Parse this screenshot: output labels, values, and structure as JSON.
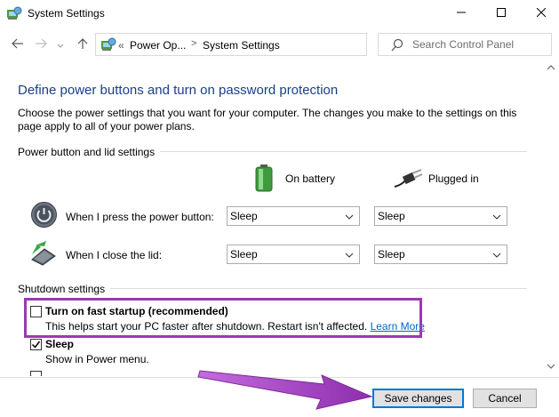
{
  "window": {
    "title": "System Settings",
    "minimize_icon": "minimize-icon",
    "maximize_icon": "maximize-icon",
    "close_icon": "close-icon"
  },
  "nav": {
    "back_icon": "arrow-left-icon",
    "forward_icon": "arrow-right-icon",
    "recent_icon": "chevron-down-icon",
    "up_icon": "arrow-up-icon",
    "address": {
      "overflow": "«",
      "crumbs": [
        "Power Op...",
        "System Settings"
      ],
      "separator": ">"
    },
    "refresh_icon": "refresh-icon",
    "search": {
      "placeholder": "Search Control Panel",
      "value": ""
    }
  },
  "page": {
    "heading": "Define power buttons and turn on password protection",
    "description": "Choose the power settings that you want for your computer. The changes you make to the settings on this page apply to all of your power plans."
  },
  "power_section": {
    "label": "Power button and lid settings",
    "columns": [
      {
        "label": "On battery",
        "icon": "battery-icon"
      },
      {
        "label": "Plugged in",
        "icon": "plug-icon"
      }
    ],
    "rows": [
      {
        "label": "When I press the power button:",
        "icon": "power-button-icon",
        "battery_value": "Sleep",
        "plugged_value": "Sleep"
      },
      {
        "label": "When I close the lid:",
        "icon": "laptop-lid-icon",
        "battery_value": "Sleep",
        "plugged_value": "Sleep"
      }
    ]
  },
  "shutdown_section": {
    "label": "Shutdown settings",
    "items": [
      {
        "label": "Turn on fast startup (recommended)",
        "description": "This helps start your PC faster after shutdown. Restart isn't affected.",
        "link": "Learn More",
        "checked": false
      },
      {
        "label": "Sleep",
        "description": "Show in Power menu.",
        "checked": true
      }
    ]
  },
  "footer": {
    "save_label": "Save changes",
    "cancel_label": "Cancel"
  },
  "colors": {
    "highlight": "#9b38b5",
    "heading": "#1a3f86",
    "link": "#0066cc",
    "primary_border": "#0078d7"
  }
}
